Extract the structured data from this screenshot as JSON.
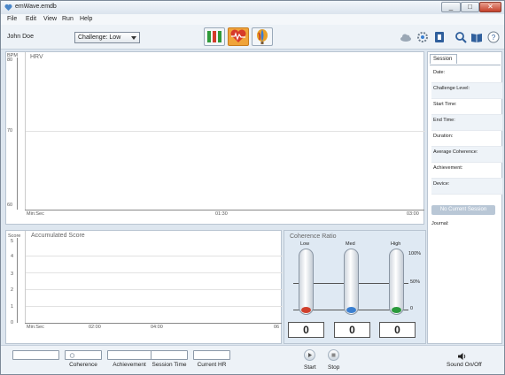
{
  "window": {
    "title": "emWave.emdb",
    "btn_min": "_",
    "btn_max": "□",
    "btn_close": "✕"
  },
  "menu": [
    "File",
    "Edit",
    "View",
    "Run",
    "Help"
  ],
  "toolbar": {
    "user": "John Doe",
    "challenge": "Challenge: Low"
  },
  "hrv": {
    "title": "HRV",
    "unit": "BPM",
    "y_top": "80",
    "y_70": "70",
    "y_60": "60",
    "x_left": "Min:Sec",
    "x_mid": "01:30",
    "x_right": "03:00"
  },
  "accum": {
    "title": "Accumulated Score",
    "unit": "Score",
    "y": [
      "5",
      "4",
      "3",
      "2",
      "1",
      "0"
    ],
    "x": [
      "Min:Sec",
      "02:00",
      "04:00",
      "06"
    ]
  },
  "coherence": {
    "title": "Coherence Ratio",
    "cols": [
      {
        "label": "Low",
        "value": "0",
        "color": "#d0402c"
      },
      {
        "label": "Med",
        "value": "0",
        "color": "#3b7fd0"
      },
      {
        "label": "High",
        "value": "0",
        "color": "#2a9a3c"
      }
    ],
    "scale": [
      "100%",
      "50%",
      "0"
    ]
  },
  "session": {
    "tab": "Session",
    "fields": [
      "Date:",
      "Challenge Level:",
      "Start Time:",
      "End Time:",
      "Duration:",
      "Average Coherence:",
      "Achievement:",
      "Device:"
    ],
    "no_current": "No Current Session",
    "journal": "Journal:"
  },
  "bottom": {
    "labels": [
      "Coherence",
      "Achievement",
      "Session Time",
      "Current HR"
    ],
    "start": "Start",
    "stop": "Stop",
    "sound": "Sound On/Off"
  }
}
